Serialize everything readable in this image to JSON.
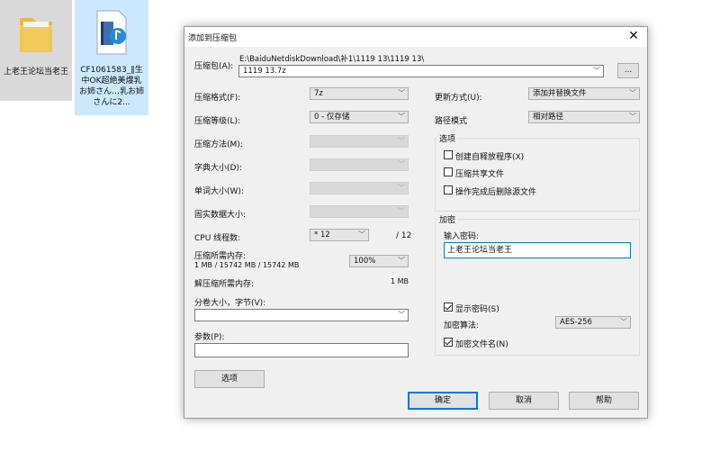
{
  "desktop": {
    "folder_label": "上老王论坛当老王",
    "video_label": "CF1061583_‖生中OK超絶美爆乳お姉さん…乳お姉さんに2..."
  },
  "dialog": {
    "title": "添加到压缩包",
    "close": "✕",
    "archive_label": "压缩包(A):",
    "archive_path": "E:\\BaiduNetdiskDownload\\补1\\1119 13\\1119 13\\",
    "archive_name": "1119 13.7z",
    "browse": "...",
    "left": {
      "format_label": "压缩格式(F):",
      "format_value": "7z",
      "level_label": "压缩等级(L):",
      "level_value": "0 - 仅存储",
      "method_label": "压缩方法(M):",
      "dict_label": "字典大小(D):",
      "word_label": "单词大小(W):",
      "solid_label": "固实数据大小:",
      "threads_label": "CPU 线程数:",
      "threads_value": "* 12",
      "threads_max": "/ 12",
      "mem_comp_label": "压缩所需内存:",
      "mem_comp_value": "1 MB / 15742 MB / 15742 MB",
      "mem_percent": "100%",
      "mem_decomp_label": "解压缩所需内存:",
      "mem_decomp_value": "1 MB",
      "volume_label": "分卷大小，字节(V):",
      "volume_value": "",
      "params_label": "参数(P):",
      "params_value": ""
    },
    "right": {
      "update_label": "更新方式(U):",
      "update_value": "添加并替换文件",
      "path_label": "路径模式",
      "path_value": "相对路径",
      "options_group": "选项",
      "opt_sfx": "创建自释放程序(X)",
      "opt_shared": "压缩共享文件",
      "opt_delete": "操作完成后删除源文件",
      "encrypt_group": "加密",
      "password_label": "输入密码:",
      "password_value": "上老王论坛当老王",
      "show_password": "显示密码(S)",
      "algo_label": "加密算法:",
      "algo_value": "AES-256",
      "encrypt_names": "加密文件名(N)"
    },
    "buttons": {
      "options": "选项",
      "ok": "确定",
      "cancel": "取消",
      "help": "帮助"
    }
  }
}
